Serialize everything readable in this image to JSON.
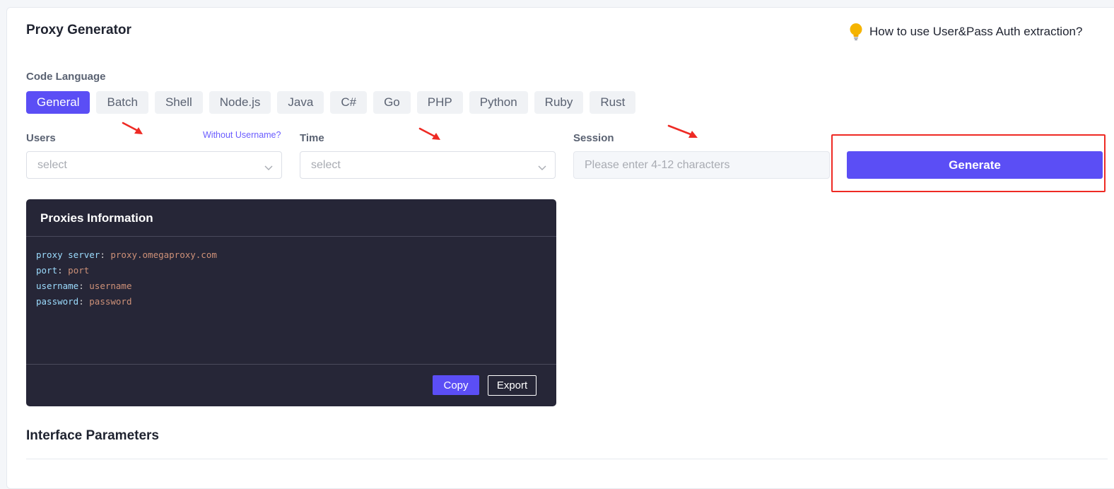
{
  "header": {
    "title": "Proxy Generator",
    "help_link": "How to use User&Pass Auth extraction?",
    "help_icon": "lightbulb-icon"
  },
  "code_language": {
    "label": "Code Language",
    "tabs": [
      "General",
      "Batch",
      "Shell",
      "Node.js",
      "Java",
      "C#",
      "Go",
      "PHP",
      "Python",
      "Ruby",
      "Rust"
    ],
    "active": "General"
  },
  "form": {
    "users_label": "Users",
    "without_username_link": "Without Username?",
    "users_placeholder": "select",
    "time_label": "Time",
    "time_placeholder": "select",
    "session_label": "Session",
    "session_placeholder": "Please enter 4-12 characters",
    "generate_label": "Generate"
  },
  "proxies_info": {
    "title": "Proxies Information",
    "lines": [
      {
        "key": "proxy server",
        "value": "proxy.omegaproxy.com"
      },
      {
        "key": "port",
        "value": "port"
      },
      {
        "key": "username",
        "value": "username"
      },
      {
        "key": "password",
        "value": "password"
      }
    ],
    "copy_label": "Copy",
    "export_label": "Export"
  },
  "interface": {
    "title": "Interface Parameters"
  },
  "colors": {
    "accent": "#5b4ef5",
    "annotation_red": "#ee2a24",
    "panel_bg": "#262637"
  }
}
